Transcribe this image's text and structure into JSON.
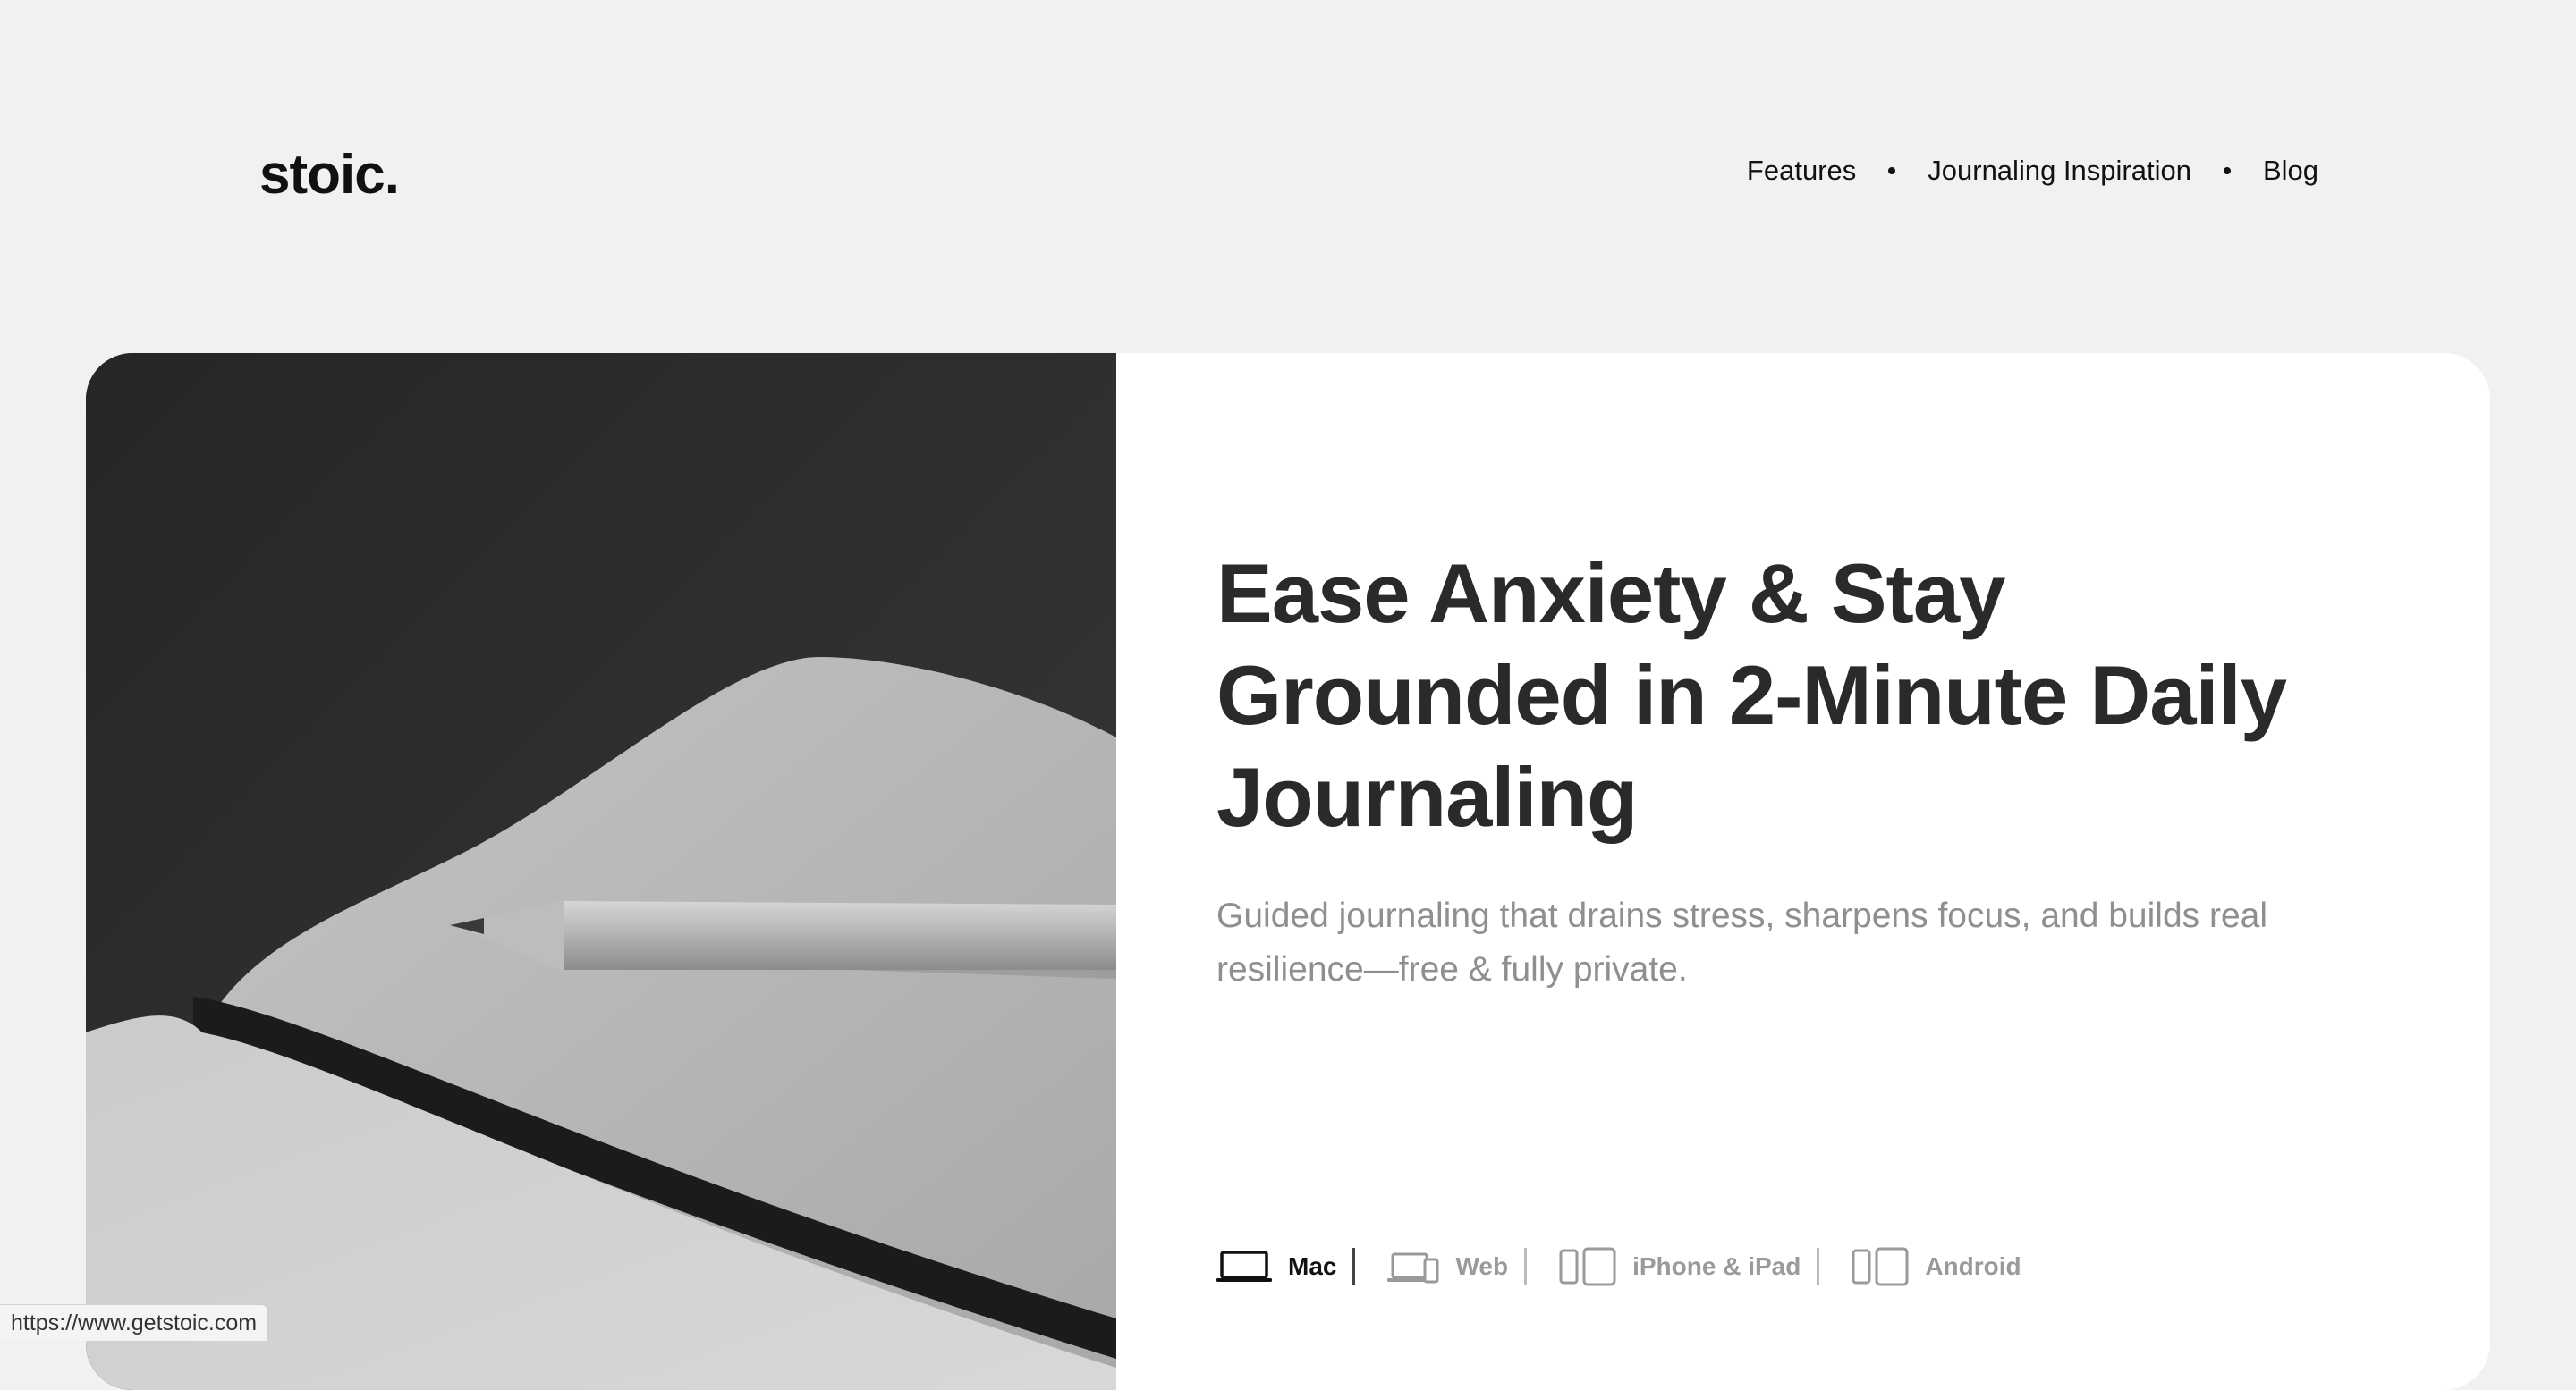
{
  "header": {
    "logo": "stoic.",
    "nav": [
      {
        "label": "Features"
      },
      {
        "label": "Journaling Inspiration"
      },
      {
        "label": "Blog"
      }
    ]
  },
  "hero": {
    "headline": "Ease Anxiety & Stay Grounded in 2-Minute Daily Journaling",
    "subhead": "Guided journaling that drains stress, sharpens focus, and builds real resilience—free & fully private.",
    "image_icon": "notebook-pencil-photo",
    "platforms": [
      {
        "label": "Mac",
        "icon": "laptop-icon",
        "active": true
      },
      {
        "label": "Web",
        "icon": "laptop-phone-icon",
        "active": false
      },
      {
        "label": "iPhone & iPad",
        "icon": "phone-tablet-icon",
        "active": false
      },
      {
        "label": "Android",
        "icon": "android-devices-icon",
        "active": false
      }
    ]
  },
  "status_bar": {
    "url": "https://www.getstoic.com"
  },
  "colors": {
    "page_bg": "#f0f1f3",
    "card_bg": "#ffffff",
    "headline": "#2a2a2a",
    "subhead": "#8f8f8f",
    "inactive_platform": "#9a9a9a"
  }
}
